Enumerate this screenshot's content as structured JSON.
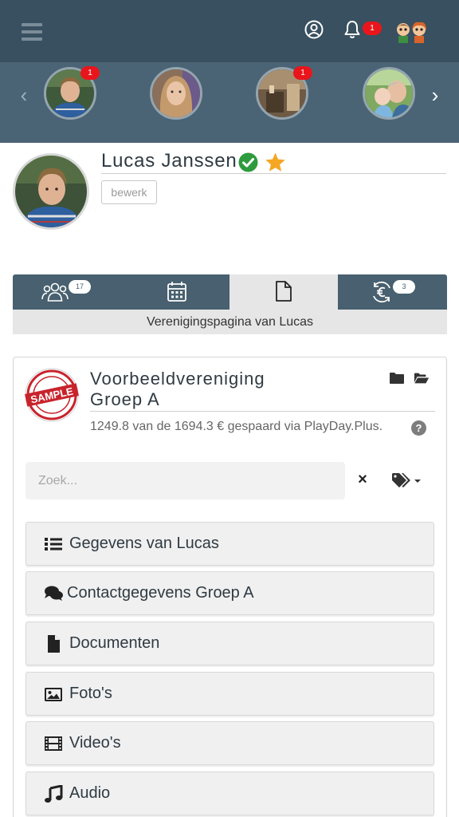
{
  "colors": {
    "topbar": "#38505f",
    "carousel": "#4a6475",
    "tabs": "#48606f",
    "badge": "#e8161c",
    "verified": "#2e9b3e",
    "star": "#f5a623"
  },
  "topbar": {
    "menu_icon": "hamburger-icon",
    "user_icon": "user-circle-icon",
    "bell_icon": "bell-icon",
    "bell_badge": "1",
    "kids_icon": "kids-avatar-icon"
  },
  "carousel": {
    "prev_icon": "chevron-left-icon",
    "next_icon": "chevron-right-icon",
    "items": [
      {
        "badge": "1"
      },
      {
        "badge": ""
      },
      {
        "badge": "1"
      },
      {
        "badge": ""
      }
    ]
  },
  "profile": {
    "name": "Lucas Janssen",
    "verified_icon": "check-circle-icon",
    "favorite_icon": "star-icon",
    "edit_label": "bewerk"
  },
  "tabs": {
    "items": [
      {
        "icon": "group-icon",
        "badge": "17"
      },
      {
        "icon": "calendar-icon",
        "badge": ""
      },
      {
        "icon": "document-icon",
        "badge": "",
        "active": true
      },
      {
        "icon": "euro-cycle-icon",
        "badge": "3"
      }
    ],
    "caption": "Verenigingspagina van Lucas"
  },
  "club": {
    "name_line1": "Voorbeeldvereniging",
    "name_line2": "Groep A",
    "logo_text": "SAMPLE",
    "savings": "1249.8 van de 1694.3 € gespaard via PlayDay.Plus.",
    "help_symbol": "?"
  },
  "search": {
    "placeholder": "Zoek...",
    "value": "",
    "clear_symbol": "×"
  },
  "menu": [
    {
      "icon": "list-icon",
      "label": "Gegevens van Lucas"
    },
    {
      "icon": "comments-icon",
      "label": "Contactgegevens Groep A"
    },
    {
      "icon": "file-icon",
      "label": "Documenten"
    },
    {
      "icon": "image-icon",
      "label": "Foto's"
    },
    {
      "icon": "film-icon",
      "label": "Video's"
    },
    {
      "icon": "music-icon",
      "label": "Audio"
    }
  ]
}
